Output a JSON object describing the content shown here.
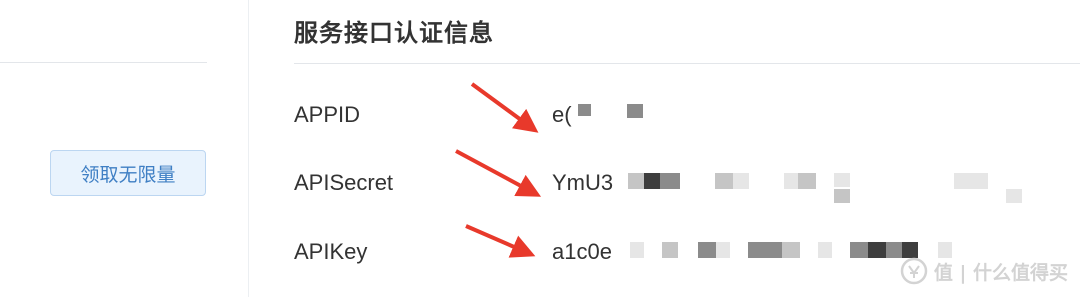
{
  "sidebar": {
    "claim_button_label": "领取无限量"
  },
  "section": {
    "title": "服务接口认证信息"
  },
  "credentials": [
    {
      "label": "APPID",
      "value_visible": "e("
    },
    {
      "label": "APISecret",
      "value_visible": "YmU3"
    },
    {
      "label": "APIKey",
      "value_visible": "a1c0e"
    }
  ],
  "annotation": {
    "arrow_color": "#e8392b"
  },
  "watermark": {
    "text": "值 | 什么值得买",
    "icon": "smzdm-logo-icon"
  },
  "colors": {
    "button_bg": "#e9f3fd",
    "button_text": "#3f7fc4",
    "divider": "#e3e6ea"
  }
}
